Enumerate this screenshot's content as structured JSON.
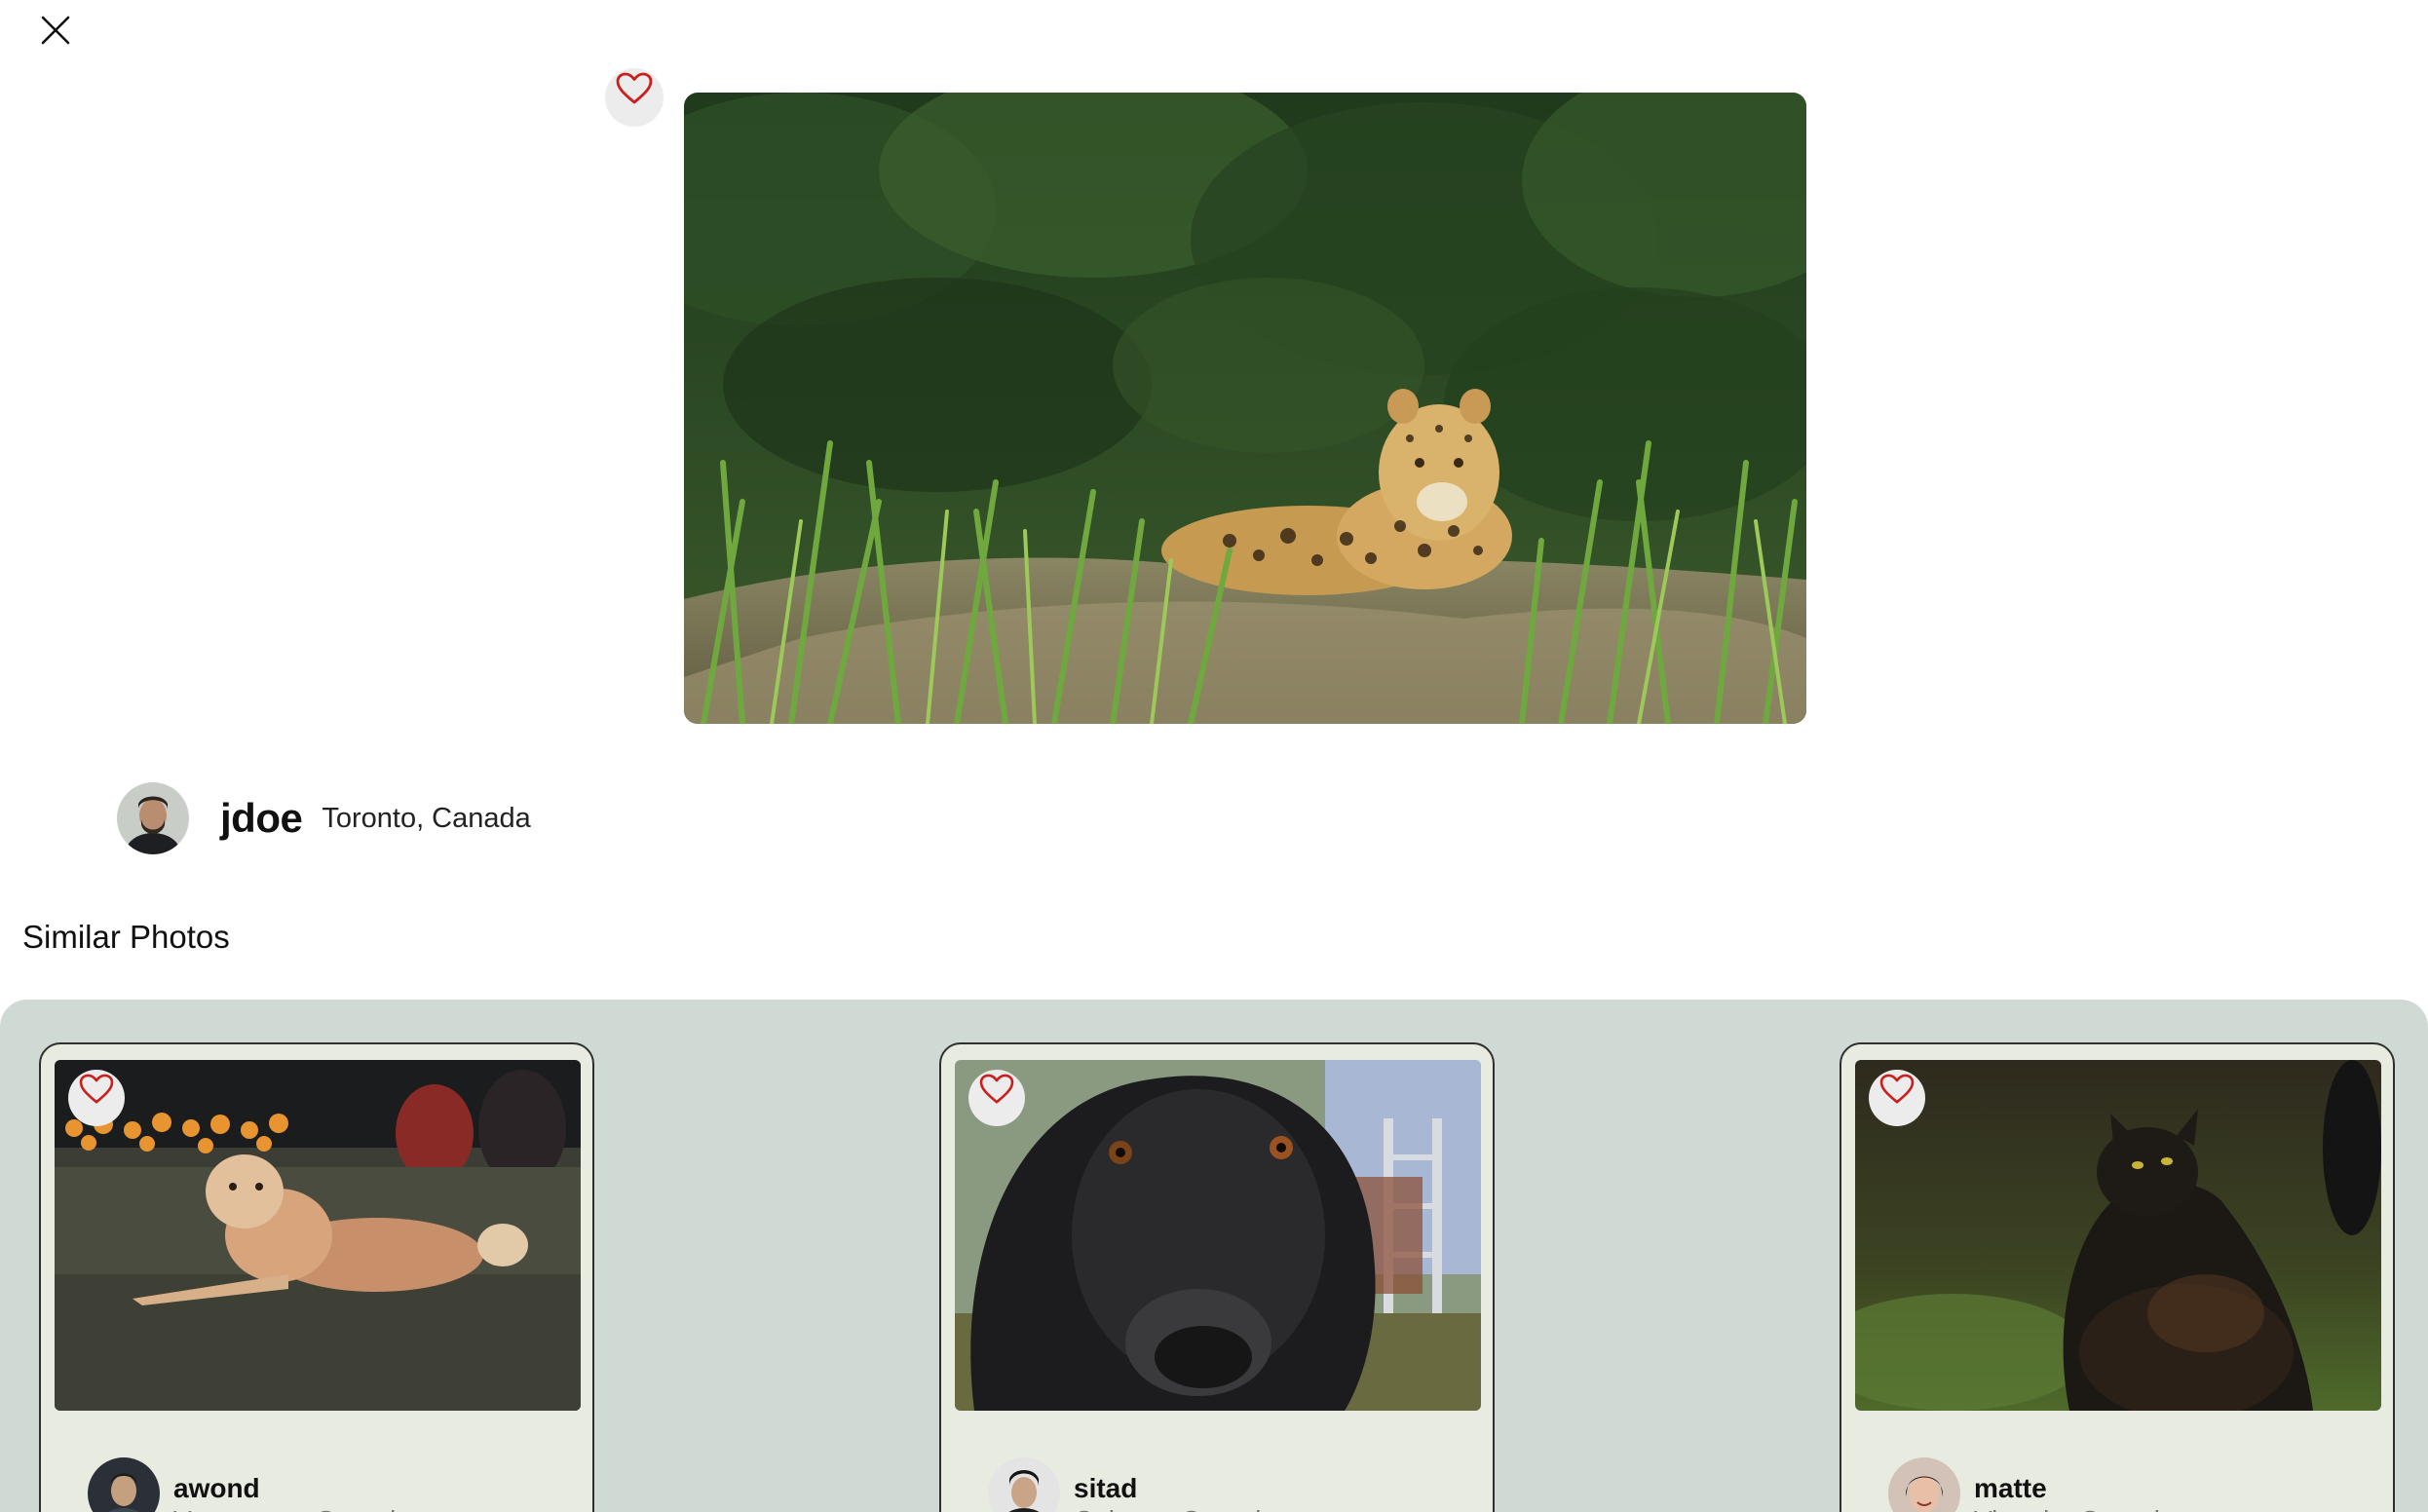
{
  "page": {
    "close_label": "close",
    "favorite_label": "favorite"
  },
  "main_photo": {
    "subject": "jaguar resting in tall grass",
    "owner": {
      "username": "jdoe",
      "location": "Toronto, Canada"
    }
  },
  "similar": {
    "title": "Similar Photos",
    "cards": [
      {
        "subject": "tan dog lying on grass",
        "username": "awond",
        "location": "Vancouver, Canada"
      },
      {
        "subject": "black dog close-up",
        "username": "sitad",
        "location": "Calgary, Canada"
      },
      {
        "subject": "black cat looking up",
        "username": "matte",
        "location": "Victoria, Canada"
      }
    ]
  },
  "colors": {
    "heart": "#c8201e",
    "panel_bg": "#d0dad5",
    "card_bg": "#e8ebdf",
    "fav_bg": "#ececec"
  },
  "icons": [
    "close-icon",
    "heart-icon"
  ]
}
